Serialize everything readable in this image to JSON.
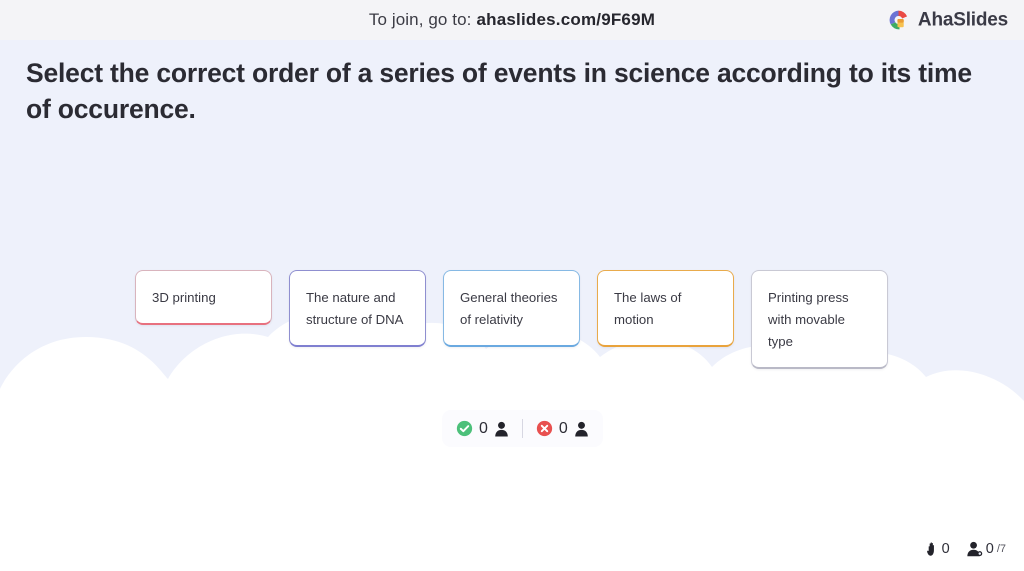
{
  "header": {
    "join_prefix": "To join, go to:",
    "join_code": "ahaslides.com/9F69M",
    "brand_name": "AhaSlides",
    "logo_icon": "ahaslides-logo-icon",
    "bg_color": "#f4f4f7"
  },
  "main": {
    "question": "Select the correct order of a series of events in science according to its time of occurence.",
    "bg_color": "#eef1fb",
    "cards": [
      {
        "label": "3D printing",
        "accent": "#e8717f",
        "style": "c-rose",
        "lines": 1
      },
      {
        "label": "The nature and structure of DNA",
        "accent": "#7f7fd0",
        "style": "c-purple",
        "lines": 2
      },
      {
        "label": "General theories of relativity",
        "accent": "#6aa9e0",
        "style": "c-blue",
        "lines": 2
      },
      {
        "label": "The laws of motion",
        "accent": "#e9a33c",
        "style": "c-amber",
        "lines": 2
      },
      {
        "label": "Printing press with movable type",
        "accent": "#b9b9c6",
        "style": "c-gray",
        "lines": 3
      }
    ]
  },
  "votes": {
    "correct_icon": "check-circle-icon",
    "correct_count": "0",
    "correct_people_icon": "person-icon",
    "incorrect_icon": "x-circle-icon",
    "incorrect_count": "0",
    "incorrect_people_icon": "person-icon",
    "correct_color": "#4cc07a",
    "incorrect_color": "#e8504f"
  },
  "status": {
    "hand_icon": "raised-hand-icon",
    "hand_count": "0",
    "participants_icon": "person-add-icon",
    "participants_count": "0",
    "participants_total": "/7"
  }
}
